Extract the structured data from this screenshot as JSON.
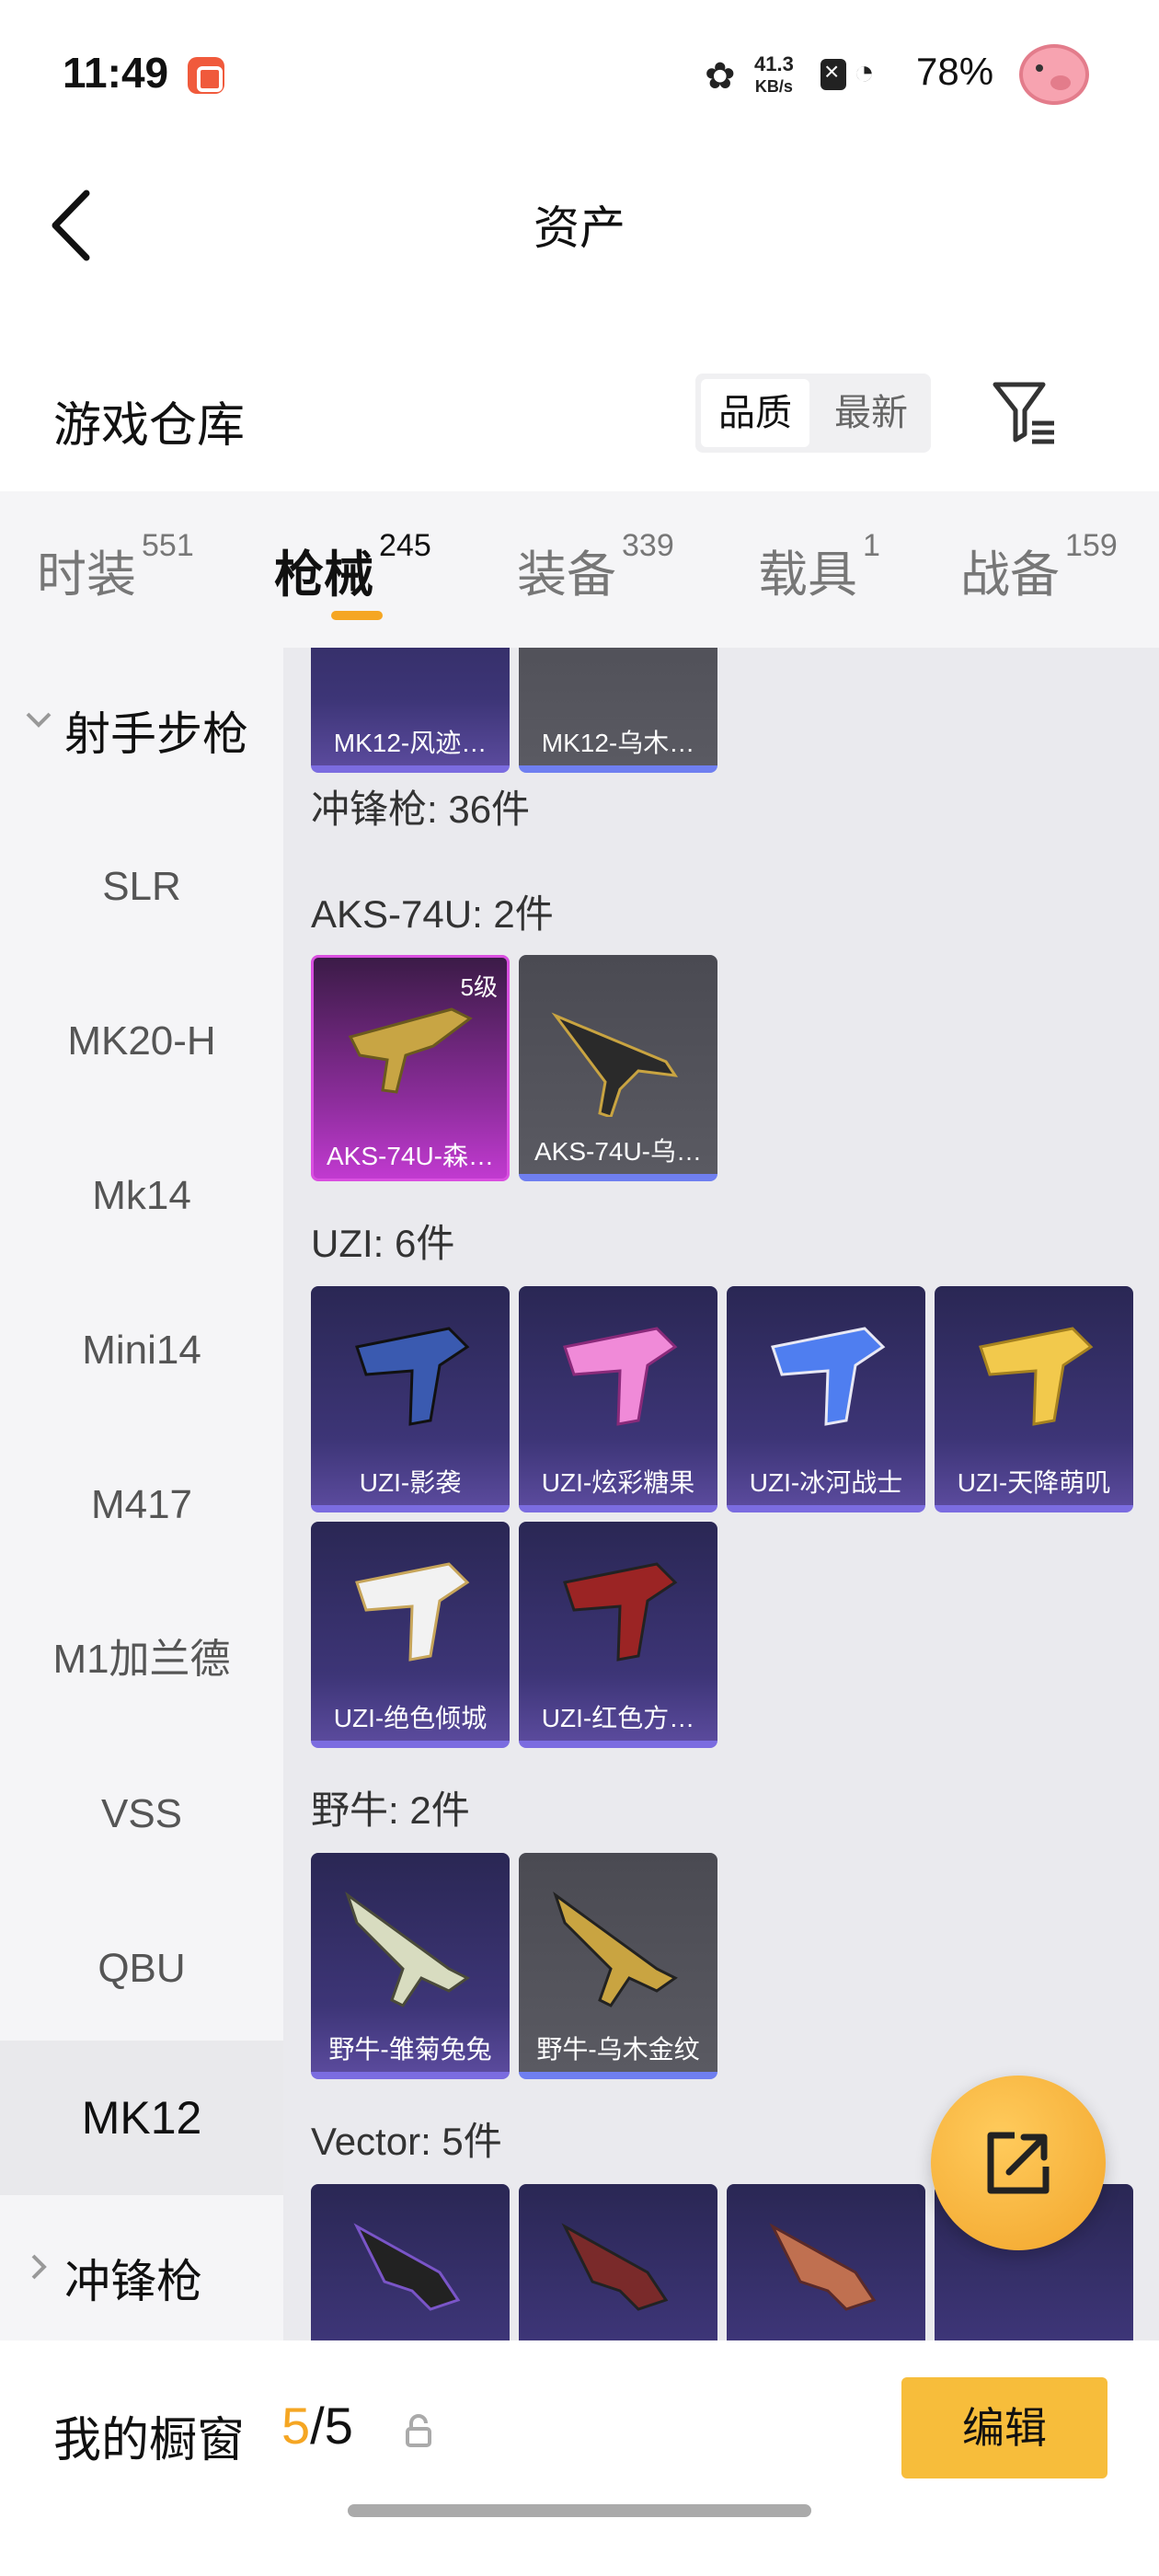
{
  "status_bar": {
    "time": "11:49",
    "speed_top": "41.3",
    "speed_unit": "KB/s",
    "battery": "78%"
  },
  "header": {
    "title": "资产"
  },
  "warehouse": {
    "title": "游戏仓库",
    "sort_options": [
      "品质",
      "最新"
    ],
    "active_sort": "品质"
  },
  "tabs": [
    {
      "label": "时装",
      "count": "551"
    },
    {
      "label": "枪械",
      "count": "245"
    },
    {
      "label": "装备",
      "count": "339"
    },
    {
      "label": "载具",
      "count": "1"
    },
    {
      "label": "战备",
      "count": "159"
    }
  ],
  "active_tab": "枪械",
  "sidebar": {
    "category_open": "射手步枪",
    "items": [
      "SLR",
      "MK20-H",
      "Mk14",
      "Mini14",
      "M417",
      "M1加兰德",
      "VSS",
      "QBU",
      "MK12"
    ],
    "active_item": "MK12",
    "category_collapsed": "冲锋枪"
  },
  "content": {
    "top_cards": [
      "MK12-风迹…",
      "MK12-乌木…"
    ],
    "smg_summary": "冲锋枪: 36件",
    "groups": [
      {
        "title": "AKS-74U: 2件",
        "cards": [
          {
            "name": "AKS-74U-森…",
            "level": "5级"
          },
          {
            "name": "AKS-74U-乌…"
          }
        ]
      },
      {
        "title": "UZI: 6件",
        "cards": [
          {
            "name": "UZI-影袭"
          },
          {
            "name": "UZI-炫彩糖果"
          },
          {
            "name": "UZI-冰河战士"
          },
          {
            "name": "UZI-天降萌叽"
          },
          {
            "name": "UZI-绝色倾城"
          },
          {
            "name": "UZI-红色方…"
          }
        ]
      },
      {
        "title": "野牛: 2件",
        "cards": [
          {
            "name": "野牛-雏菊兔兔"
          },
          {
            "name": "野牛-乌木金纹"
          }
        ]
      },
      {
        "title": "Vector: 5件",
        "cards": []
      }
    ]
  },
  "showcase": {
    "label": "我的橱窗",
    "current": "5",
    "separator": "/",
    "total": "5",
    "edit_label": "编辑"
  },
  "colors": {
    "accent": "#f5a623",
    "edit_button": "#f7bd3b",
    "card_purple": "#3d3577",
    "card_pink": "#c13ad0",
    "card_gray": "#55555c"
  }
}
